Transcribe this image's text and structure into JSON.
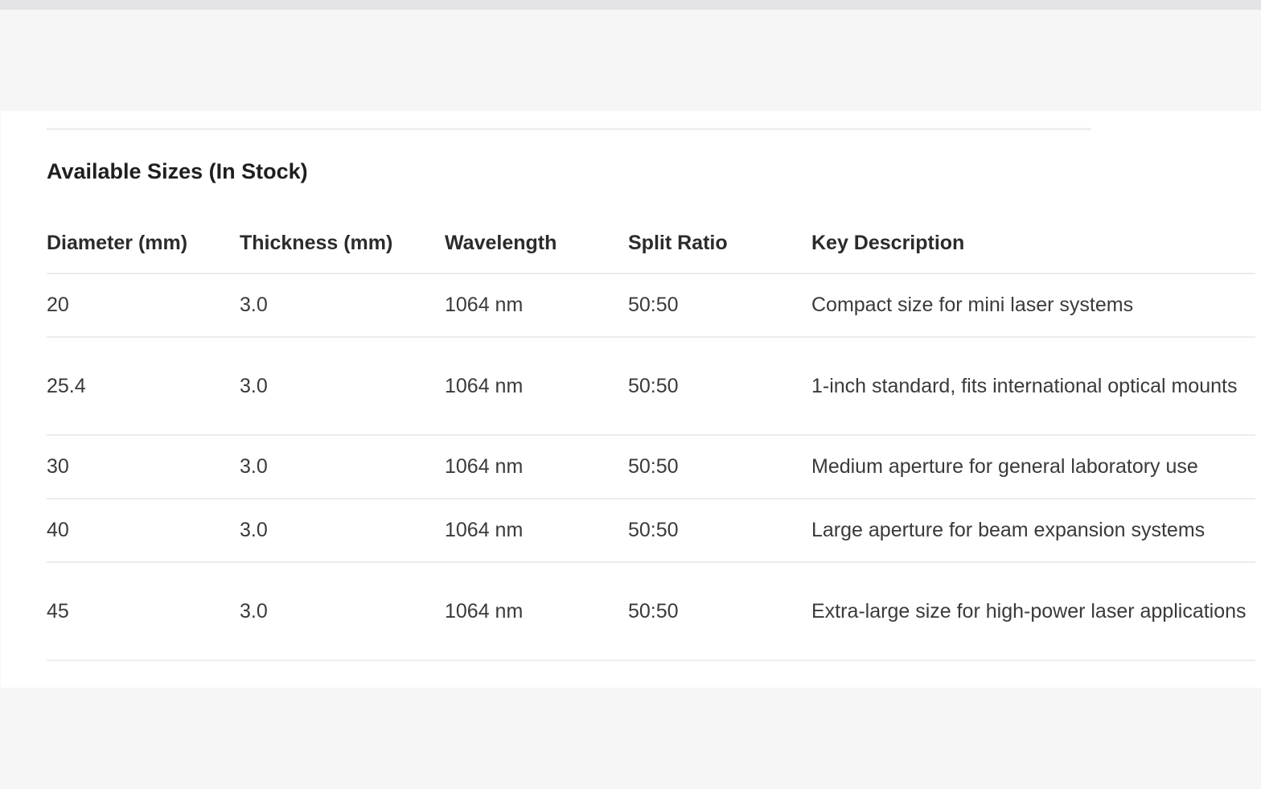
{
  "section": {
    "title": "Available Sizes (In Stock)"
  },
  "table": {
    "headers": [
      "Diameter (mm)",
      "Thickness (mm)",
      "Wavelength",
      "Split Ratio",
      "Key Description"
    ],
    "rows": [
      [
        "20",
        "3.0",
        "1064 nm",
        "50:50",
        "Compact size for mini laser systems"
      ],
      [
        "25.4",
        "3.0",
        "1064 nm",
        "50:50",
        "1-inch standard, fits international optical mounts"
      ],
      [
        "30",
        "3.0",
        "1064 nm",
        "50:50",
        "Medium aperture for general laboratory use"
      ],
      [
        "40",
        "3.0",
        "1064 nm",
        "50:50",
        "Large aperture for beam expansion systems"
      ],
      [
        "45",
        "3.0",
        "1064 nm",
        "50:50",
        "Extra-large size for high-power laser applications"
      ]
    ]
  },
  "colors": {
    "page_background": "#f6f6f6",
    "card_background": "#ffffff",
    "divider": "#ececec",
    "text": "#222222"
  }
}
